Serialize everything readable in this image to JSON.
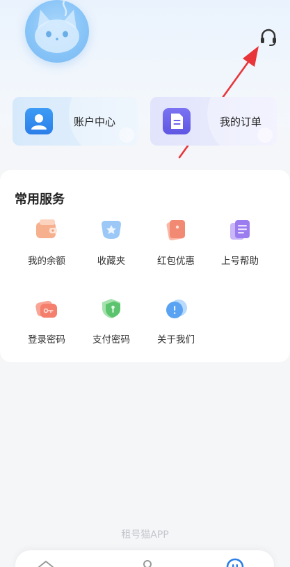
{
  "header": {
    "avatar_icon": "cat-mascot-icon",
    "support_icon": "headset-icon",
    "annotation": "red-arrow"
  },
  "quick_cards": [
    {
      "label": "账户中心",
      "icon": "user-profile-icon",
      "color": "#2b7ee8"
    },
    {
      "label": "我的订单",
      "icon": "document-icon",
      "color": "#5f56e3"
    }
  ],
  "services": {
    "title": "常用服务",
    "items": [
      {
        "label": "我的余额",
        "icon": "wallet-icon"
      },
      {
        "label": "收藏夹",
        "icon": "star-folder-icon"
      },
      {
        "label": "红包优惠",
        "icon": "red-packet-icon"
      },
      {
        "label": "上号帮助",
        "icon": "help-document-icon"
      },
      {
        "label": "登录密码",
        "icon": "key-icon"
      },
      {
        "label": "支付密码",
        "icon": "shield-lock-icon"
      },
      {
        "label": "关于我们",
        "icon": "info-bubble-icon"
      }
    ]
  },
  "footer": {
    "brand": "租号猫APP"
  },
  "tabbar": {
    "items": [
      {
        "icon": "home-icon"
      },
      {
        "icon": "profile-icon"
      },
      {
        "icon": "smile-icon",
        "active": true
      }
    ]
  },
  "colors": {
    "accent": "#2b7ee8",
    "arrow": "#e8353a"
  }
}
